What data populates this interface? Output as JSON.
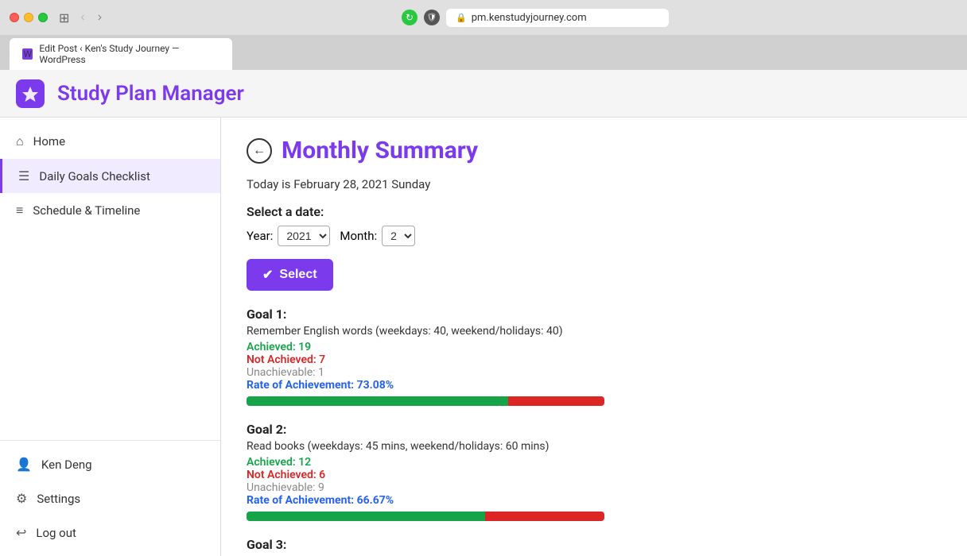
{
  "browser": {
    "tab_label": "Edit Post ‹ Ken's Study Journey — WordPress",
    "address": "pm.kenstudyjourney.com"
  },
  "app": {
    "title": "Study Plan Manager",
    "logo_letter": "✦"
  },
  "sidebar": {
    "items": [
      {
        "id": "home",
        "label": "Home",
        "icon": "⌂",
        "active": false
      },
      {
        "id": "daily-goals",
        "label": "Daily Goals Checklist",
        "icon": "☰",
        "active": true
      },
      {
        "id": "schedule",
        "label": "Schedule & Timeline",
        "icon": "≡",
        "active": false
      }
    ],
    "bottom_items": [
      {
        "id": "user",
        "label": "Ken Deng",
        "icon": "👤",
        "active": false
      },
      {
        "id": "settings",
        "label": "Settings",
        "icon": "⚙",
        "active": false
      },
      {
        "id": "logout",
        "label": "Log out",
        "icon": "↩",
        "active": false
      }
    ]
  },
  "main": {
    "page_title": "Monthly Summary",
    "today_text": "Today is February 28, 2021 Sunday",
    "date_section": {
      "label": "Select a date:",
      "year_label": "Year:",
      "year_value": "2021",
      "month_label": "Month:",
      "month_value": "2"
    },
    "select_button": "Select",
    "goals": [
      {
        "id": "goal1",
        "title": "Goal 1:",
        "description": "Remember English words (weekdays: 40, weekend/holidays: 40)",
        "achieved": "Achieved: 19",
        "not_achieved": "Not Achieved: 7",
        "unachievable": "Unachievable: 1",
        "rate": "Rate of Achievement: 73.08%",
        "green_pct": 73.08,
        "red_pct": 26.92
      },
      {
        "id": "goal2",
        "title": "Goal 2:",
        "description": "Read books (weekdays: 45 mins, weekend/holidays: 60 mins)",
        "achieved": "Achieved: 12",
        "not_achieved": "Not Achieved: 6",
        "unachievable": "Unachievable: 9",
        "rate": "Rate of Achievement: 66.67%",
        "green_pct": 66.67,
        "red_pct": 33.33
      },
      {
        "id": "goal3",
        "title": "Goal 3:",
        "description": "",
        "achieved": "",
        "not_achieved": "",
        "unachievable": "",
        "rate": "",
        "green_pct": 0,
        "red_pct": 0
      }
    ]
  }
}
